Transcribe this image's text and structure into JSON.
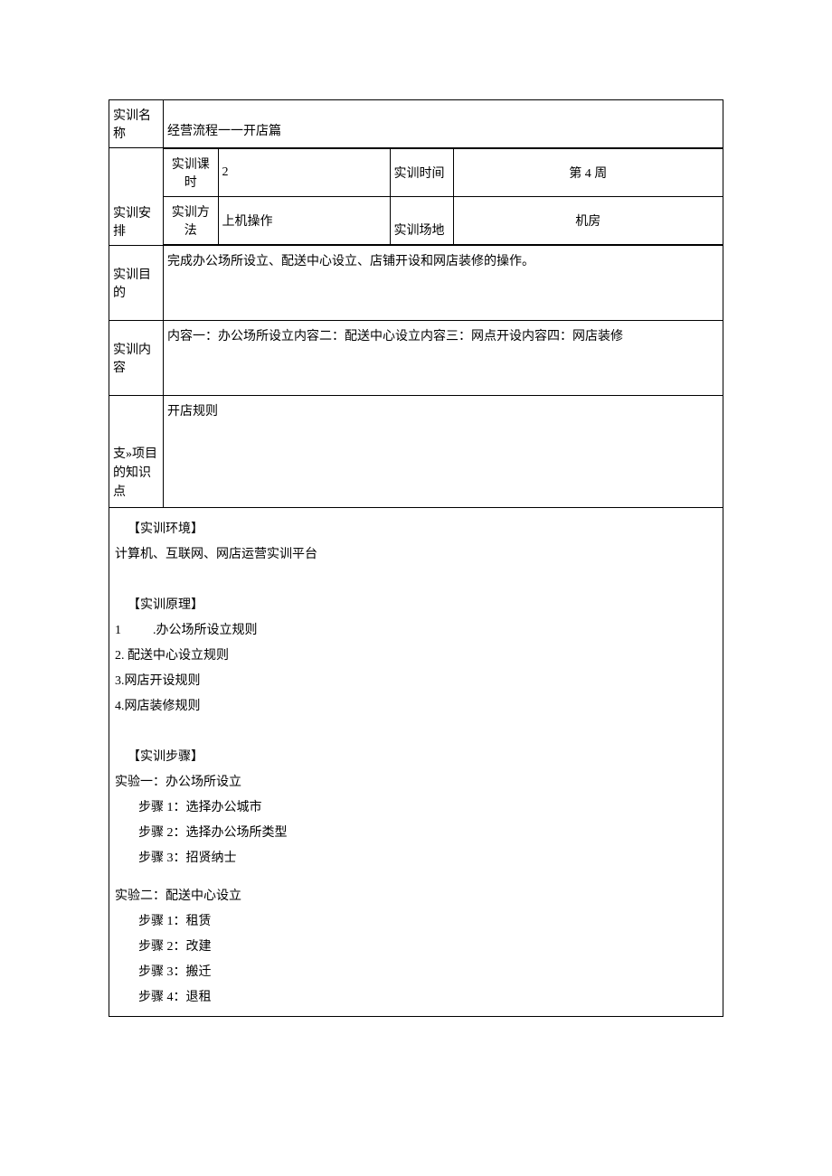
{
  "labels": {
    "training_name": "实训名称",
    "training_arrange": "实训安排",
    "training_period": "实训课时",
    "training_time": "实训时间",
    "training_method": "实训方法",
    "training_place": "实训场地",
    "training_goal": "实训目的",
    "training_content": "实训内容",
    "support_knowledge_line1": "支»项目",
    "support_knowledge_line2": "的知识点"
  },
  "values": {
    "training_name": "经营流程一一开店篇",
    "period_value": "2",
    "time_value": "第 4 周",
    "method_value": "上机操作",
    "place_value": "机房",
    "goal_value": "完成办公场所设立、配送中心设立、店铺开设和网店装修的操作。",
    "content_value": "内容一：办公场所设立内容二：配送中心设立内容三：网点开设内容四：网店装修",
    "knowledge_value": "开店规则"
  },
  "body": {
    "env_heading": "【实训环境】",
    "env_text": "计算机、互联网、网店运营实训平台",
    "principle_heading": "【实训原理】",
    "principles": [
      "1          .办公场所设立规则",
      "2. 配送中心设立规则",
      "3.网店开设规则",
      "4.网店装修规则"
    ],
    "steps_heading": "【实训步骤】",
    "exp1_title": "实验一：办公场所设立",
    "exp1_steps": [
      "步骤 1：选择办公城市",
      "步骤 2：选择办公场所类型",
      "步骤 3：招贤纳士"
    ],
    "exp2_title": "实验二：配送中心设立",
    "exp2_steps": [
      "步骤 1：租赁",
      "步骤 2：改建",
      "步骤 3：搬迁",
      "步骤 4：退租"
    ]
  }
}
